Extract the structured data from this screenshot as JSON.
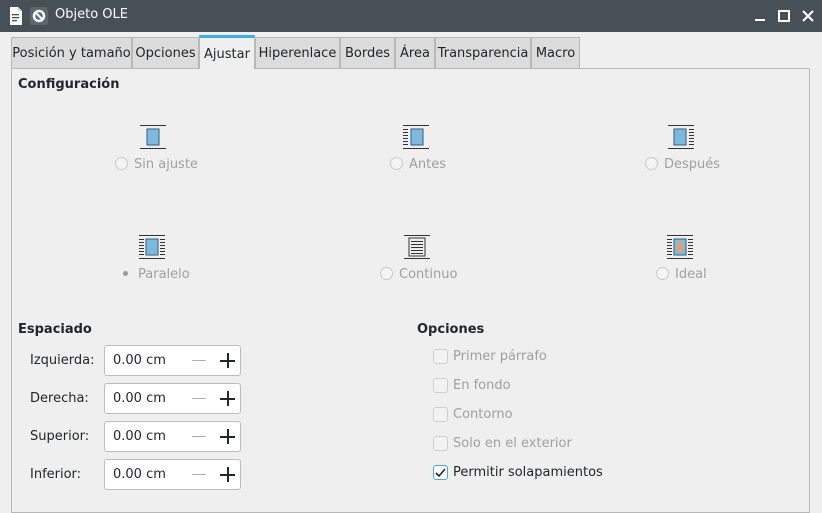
{
  "window": {
    "title": "Objeto OLE"
  },
  "tabs": [
    {
      "label": "Posición y tamaño"
    },
    {
      "label": "Opciones"
    },
    {
      "label": "Ajustar"
    },
    {
      "label": "Hiperenlace"
    },
    {
      "label": "Bordes"
    },
    {
      "label": "Área"
    },
    {
      "label": "Transparencia"
    },
    {
      "label": "Macro"
    }
  ],
  "active_tab": "Ajustar",
  "configuracion": {
    "heading": "Configuración",
    "options": [
      {
        "label": "Sin ajuste",
        "icon": "wrap-none-icon",
        "selected": false
      },
      {
        "label": "Antes",
        "icon": "wrap-before-icon",
        "selected": false
      },
      {
        "label": "Después",
        "icon": "wrap-after-icon",
        "selected": false
      },
      {
        "label": "Paralelo",
        "icon": "wrap-parallel-icon",
        "selected": true
      },
      {
        "label": "Continuo",
        "icon": "wrap-through-icon",
        "selected": false
      },
      {
        "label": "Ideal",
        "icon": "wrap-optimal-icon",
        "selected": false
      }
    ]
  },
  "espaciado": {
    "heading": "Espaciado",
    "fields": [
      {
        "label": "Izquierda:",
        "value": "0.00 cm"
      },
      {
        "label": "Derecha:",
        "value": "0.00 cm"
      },
      {
        "label": "Superior:",
        "value": "0.00 cm"
      },
      {
        "label": "Inferior:",
        "value": "0.00 cm"
      }
    ]
  },
  "opciones": {
    "heading": "Opciones",
    "items": [
      {
        "label": "Primer párrafo",
        "checked": false,
        "enabled": false
      },
      {
        "label": "En fondo",
        "checked": false,
        "enabled": false
      },
      {
        "label": "Contorno",
        "checked": false,
        "enabled": false
      },
      {
        "label": "Solo en el exterior",
        "checked": false,
        "enabled": false
      },
      {
        "label": "Permitir solapamientos",
        "checked": true,
        "enabled": true
      }
    ]
  },
  "colors": {
    "titlebar": "#475057",
    "accent": "#3daee9",
    "icon_fill": "#7fb9dd"
  }
}
